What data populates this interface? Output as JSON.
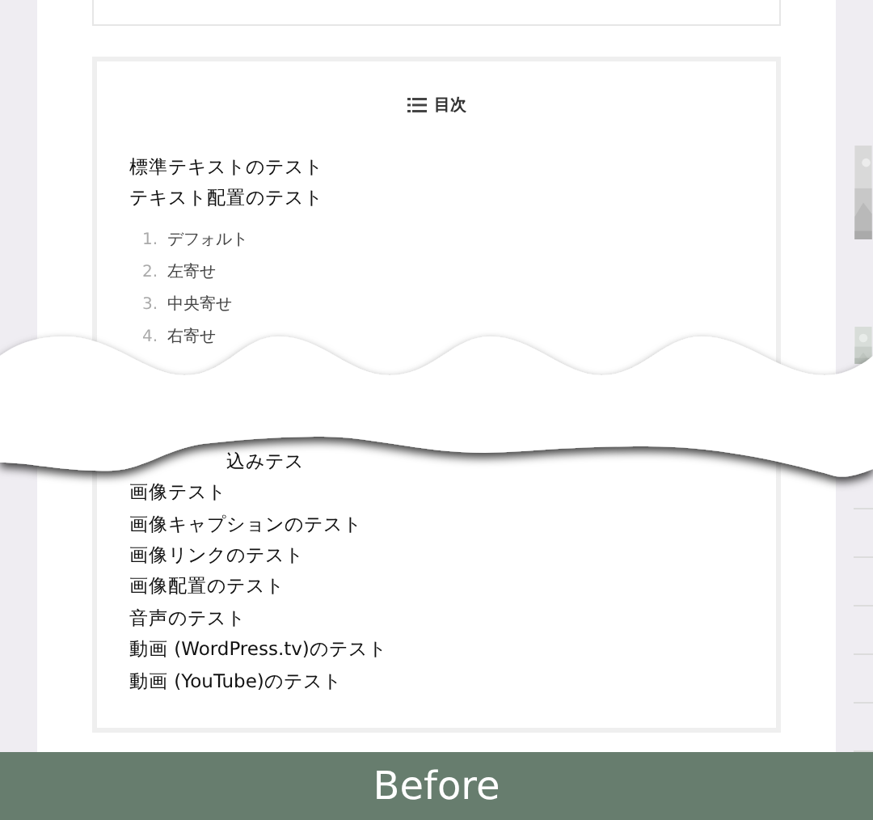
{
  "toc": {
    "title": "目次",
    "items": [
      {
        "text": "標準テキストのテスト"
      },
      {
        "text": "テキスト配置のテスト",
        "children": [
          {
            "number": "1.",
            "text": "デフォルト"
          },
          {
            "number": "2.",
            "text": "左寄せ"
          },
          {
            "number": "3.",
            "text": "中央寄せ"
          },
          {
            "number": "4.",
            "text": "右寄せ"
          }
        ]
      }
    ],
    "fragment": "込みテス",
    "items_after": [
      {
        "text": "画像テスト"
      },
      {
        "text": "画像キャプションのテスト"
      },
      {
        "text": "画像リンクのテスト"
      },
      {
        "text": "画像配置のテスト"
      },
      {
        "text": "音声のテスト"
      },
      {
        "text": "動画 (WordPress.tv)のテスト"
      },
      {
        "text": "動画 (YouTube)のテスト"
      }
    ]
  },
  "banner": {
    "label": "Before"
  }
}
